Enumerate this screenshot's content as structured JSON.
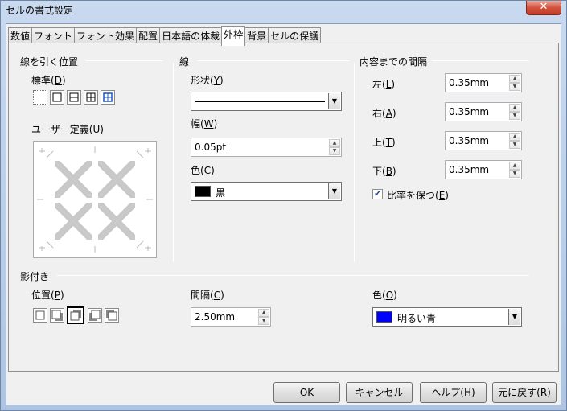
{
  "window": {
    "title": "セルの書式設定",
    "close_glyph": "✕"
  },
  "tabs": [
    {
      "label": "数値"
    },
    {
      "label": "フォント"
    },
    {
      "label": "フォント効果"
    },
    {
      "label": "配置"
    },
    {
      "label": "日本語の体裁"
    },
    {
      "label": "外枠",
      "active": true
    },
    {
      "label": "背景"
    },
    {
      "label": "セルの保護"
    }
  ],
  "line_arrangement": {
    "title": "線を引く位置",
    "default_label": "標準(",
    "default_key": "D",
    "user_defined_label": "ユーザー定義(",
    "user_defined_key": "U"
  },
  "line": {
    "title": "線",
    "style_label": "形状(",
    "style_key": "Y",
    "width_label": "幅(",
    "width_key": "W",
    "width_value": "0.05pt",
    "color_label": "色(",
    "color_key": "C",
    "color_value": "黒",
    "color_swatch": "#000000"
  },
  "spacing": {
    "title": "内容までの間隔",
    "left_label": "左(",
    "left_key": "L",
    "left_value": "0.35mm",
    "right_label": "右(",
    "right_key": "A",
    "right_value": "0.35mm",
    "top_label": "上(",
    "top_key": "T",
    "top_value": "0.35mm",
    "bottom_label": "下(",
    "bottom_key": "B",
    "bottom_value": "0.35mm",
    "sync_label": "比率を保つ(",
    "sync_key": "E",
    "sync_checked": true
  },
  "shadow": {
    "title": "影付き",
    "position_label": "位置(",
    "position_key": "P",
    "distance_label": "間隔(",
    "distance_key": "C",
    "distance_value": "2.50mm",
    "color_label": "色(",
    "color_key": "O",
    "color_value": "明るい青",
    "color_swatch": "#0000ff"
  },
  "buttons": {
    "ok": "OK",
    "cancel": "キャンセル",
    "help_label": "ヘルプ(",
    "help_key": "H",
    "reset_label": "元に戻す(",
    "reset_key": "R"
  }
}
